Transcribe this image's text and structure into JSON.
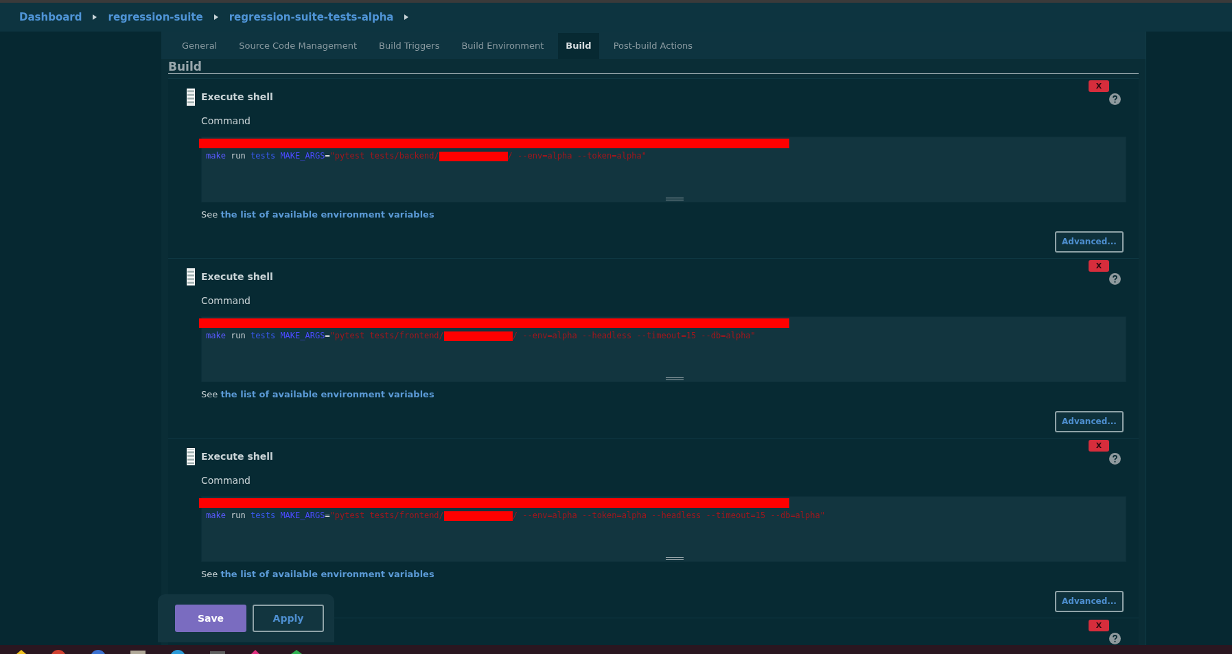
{
  "breadcrumbs": [
    {
      "label": "Dashboard"
    },
    {
      "label": "regression-suite"
    },
    {
      "label": "regression-suite-tests-alpha"
    }
  ],
  "tabs": [
    {
      "label": "General",
      "selected": false
    },
    {
      "label": "Source Code Management",
      "selected": false
    },
    {
      "label": "Build Triggers",
      "selected": false
    },
    {
      "label": "Build Environment",
      "selected": false
    },
    {
      "label": "Build",
      "selected": true
    },
    {
      "label": "Post-build Actions",
      "selected": false
    }
  ],
  "section_heading": "Build",
  "steps": [
    {
      "title": "Execute shell",
      "delete_label": "X",
      "field_label": "Command",
      "code": [
        {
          "kind": "keyword",
          "text": "make"
        },
        {
          "kind": "plain",
          "text": " run "
        },
        {
          "kind": "target",
          "text": "tests"
        },
        {
          "kind": "variable",
          "text": "MAKE_ARGS"
        },
        {
          "kind": "operator",
          "text": "="
        },
        {
          "kind": "string",
          "text": "\"pytest tests/backend/"
        },
        {
          "kind": "redacted"
        },
        {
          "kind": "string",
          "text": "/ --env=alpha --token=alpha\""
        }
      ],
      "hint": "See ",
      "hint_link": "the list of available environment variables",
      "advanced_label": "Advanced..."
    },
    {
      "title": "Execute shell",
      "delete_label": "X",
      "field_label": "Command",
      "code": [
        {
          "kind": "keyword",
          "text": "make"
        },
        {
          "kind": "plain",
          "text": " run "
        },
        {
          "kind": "target",
          "text": "tests"
        },
        {
          "kind": "variable",
          "text": "MAKE_ARGS"
        },
        {
          "kind": "operator",
          "text": "="
        },
        {
          "kind": "string",
          "text": "\"pytest tests/frontend/"
        },
        {
          "kind": "redacted"
        },
        {
          "kind": "string",
          "text": "/ --env=alpha --headless --timeout=15 --db=alpha\""
        }
      ],
      "hint": "See ",
      "hint_link": "the list of available environment variables",
      "advanced_label": "Advanced..."
    },
    {
      "title": "Execute shell",
      "delete_label": "X",
      "field_label": "Command",
      "code": [
        {
          "kind": "keyword",
          "text": "make"
        },
        {
          "kind": "plain",
          "text": " run "
        },
        {
          "kind": "target",
          "text": "tests"
        },
        {
          "kind": "variable",
          "text": "MAKE_ARGS"
        },
        {
          "kind": "operator",
          "text": "="
        },
        {
          "kind": "string",
          "text": "\"pytest tests/frontend/"
        },
        {
          "kind": "redacted"
        },
        {
          "kind": "string",
          "text": "/ --env=alpha --token=alpha --headless --timeout=15 --db=alpha\""
        }
      ],
      "hint": "See ",
      "hint_link": "the list of available environment variables",
      "advanced_label": "Advanced..."
    },
    {
      "delete_label": "X"
    }
  ],
  "actions": {
    "save": "Save",
    "apply": "Apply"
  }
}
